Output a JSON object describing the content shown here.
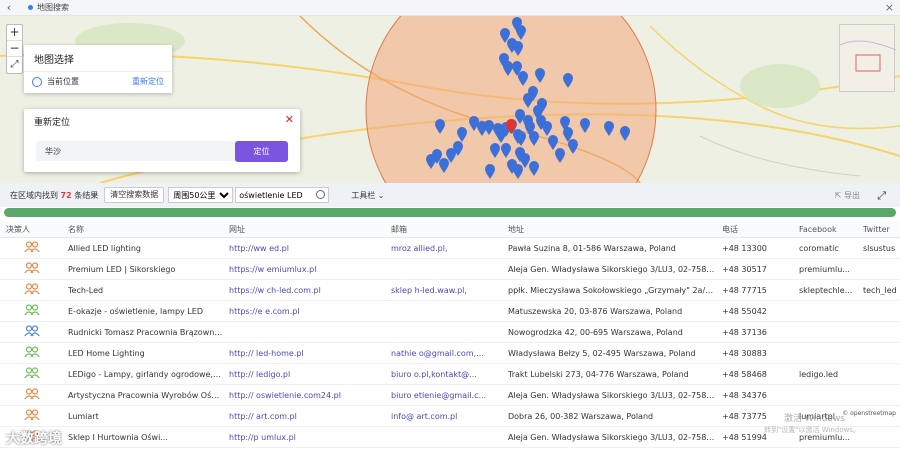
{
  "window": {
    "title": "地图搜索"
  },
  "map": {
    "panel_title": "地图选择",
    "current_location_label": "当前位置",
    "relocate_link": "重新定位",
    "relocate_dialog": {
      "title": "重新定位",
      "input_value": "华沙",
      "button": "定位"
    },
    "attribution": "openstreetmap"
  },
  "toolbar": {
    "count_prefix": "在区域内找到",
    "count_value": "72",
    "count_suffix": "条结果",
    "clear_button": "清空搜索数据",
    "radius_select": "周围50公里",
    "search_value": "oświetlenie LED",
    "tools_label": "工具栏",
    "export_label": "导出"
  },
  "progress": {
    "value": 1.0
  },
  "table": {
    "columns": [
      "决策人",
      "名称",
      "网址",
      "邮箱",
      "地址",
      "电话",
      "Facebook",
      "Twitter"
    ],
    "rows": [
      {
        "name": "Allied LED lighting",
        "website": "http://ww          ed.pl",
        "email": "mroz        allied.pl,",
        "address": "Pawła Suzina 8, 01-586 Warszawa, Poland",
        "phone": "+48      13300",
        "facebook": "coromatic",
        "twitter": "slsustus",
        "avatar": "orange"
      },
      {
        "name": "Premium LED | Sikorskiego",
        "website": "https://w        emiumlux.pl",
        "email": "",
        "address": "Aleja Gen. Władysława Sikorskiego 3/LU3, 02-758 Wa...",
        "phone": "+48      30517",
        "facebook": "premiumlu...",
        "twitter": "",
        "avatar": "orange"
      },
      {
        "name": "Tech-Led",
        "website": "https://w        ch-led.com.pl",
        "email": "sklep       h-led.waw.pl,",
        "address": "ppłk. Mieczysława Sokołowskiego „Grzymały\" 2a/pa...",
        "phone": "+48      77715",
        "facebook": "skleptechle...",
        "twitter": "tech_led",
        "avatar": "orange"
      },
      {
        "name": "E-okazje - oświetlenie, lampy LED",
        "website": "https://e        e.com.pl",
        "email": "",
        "address": "Matuszewska 20, 03-876 Warszawa, Poland",
        "phone": "+48      55042",
        "facebook": "",
        "twitter": "",
        "avatar": "green"
      },
      {
        "name": "Rudnicki Tomasz Pracownia Brązownic...",
        "website": "",
        "email": "",
        "address": "Nowogrodzka 42, 00-695 Warszawa, Poland",
        "phone": "+48      37136",
        "facebook": "",
        "twitter": "",
        "avatar": "blue"
      },
      {
        "name": "LED Home Lighting",
        "website": "http://        led-home.pl",
        "email": "nathie       o@gmail.com,...",
        "address": "Władysława Bełzy 5, 02-495 Warszawa, Poland",
        "phone": "+48      30883",
        "facebook": "",
        "twitter": "",
        "avatar": "green"
      },
      {
        "name": "LEDigo - Lampy, girlandy ogrodowe, ż...",
        "website": "http://        ledigo.pl",
        "email": "biuro        o.pl,kontakt@...",
        "address": "Trakt Lubelski 273, 04-776 Warszawa, Poland",
        "phone": "+48      58468",
        "facebook": "ledigo.led",
        "twitter": "",
        "avatar": "green"
      },
      {
        "name": "Artystyczna Pracownia Wyrobów Oświ...",
        "website": "http://        oswietlenie.com24.pl",
        "email": "biuro       etlenie@gmail.c...",
        "address": "Aleja Gen. Władysława Sikorskiego 3/LU3, 02-758 Wa...",
        "phone": "+48      34376",
        "facebook": "",
        "twitter": "",
        "avatar": "orange"
      },
      {
        "name": "Lumiart",
        "website": "http://        art.com.pl",
        "email": "info@        art.com.pl",
        "address": "Dobra 26, 00-382 Warszawa, Poland",
        "phone": "+48      73775",
        "facebook": "lumiartpl",
        "twitter": "",
        "avatar": "orange"
      },
      {
        "name": "        Sklep I Hurtownia Oświ...",
        "website": "http://p        umlux.pl",
        "email": "",
        "address": "Aleja Gen. Władysława Sikorskiego 3/LU3, 02-758 Wa...",
        "phone": "+48      51994",
        "facebook": "premiumlu...",
        "twitter": "",
        "avatar": "orange"
      }
    ]
  },
  "overlay": {
    "activate_line1": "激活 Windows",
    "activate_line2": "转到\"设置\"以激活 Windows。",
    "logo_text": "大数跨境"
  },
  "colors": {
    "accent": "#7b55e0",
    "link": "#3b7bf5",
    "marker": "#3d6fd8",
    "center_marker": "#e5322d",
    "radius_fill": "#f4a77a",
    "progress": "#5aa86a",
    "avatar_orange": "#e8884a",
    "avatar_green": "#6fbf5a",
    "avatar_blue": "#4a86d8"
  }
}
